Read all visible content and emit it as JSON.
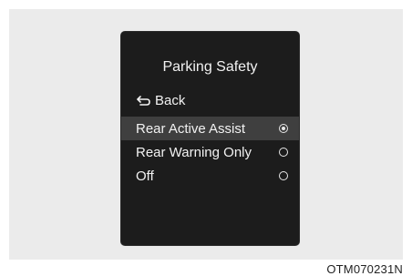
{
  "screen": {
    "title": "Parking Safety",
    "back_label": "Back",
    "options": [
      {
        "label": "Rear Active Assist",
        "selected": true
      },
      {
        "label": "Rear Warning Only",
        "selected": false
      },
      {
        "label": "Off",
        "selected": false
      }
    ]
  },
  "figure": {
    "code": "OTM070231N"
  },
  "colors": {
    "screen_bg": "#1c1c1c",
    "highlight": "#3f3f3f",
    "panel_bg": "#ebebeb",
    "text": "#f2f2f2"
  }
}
